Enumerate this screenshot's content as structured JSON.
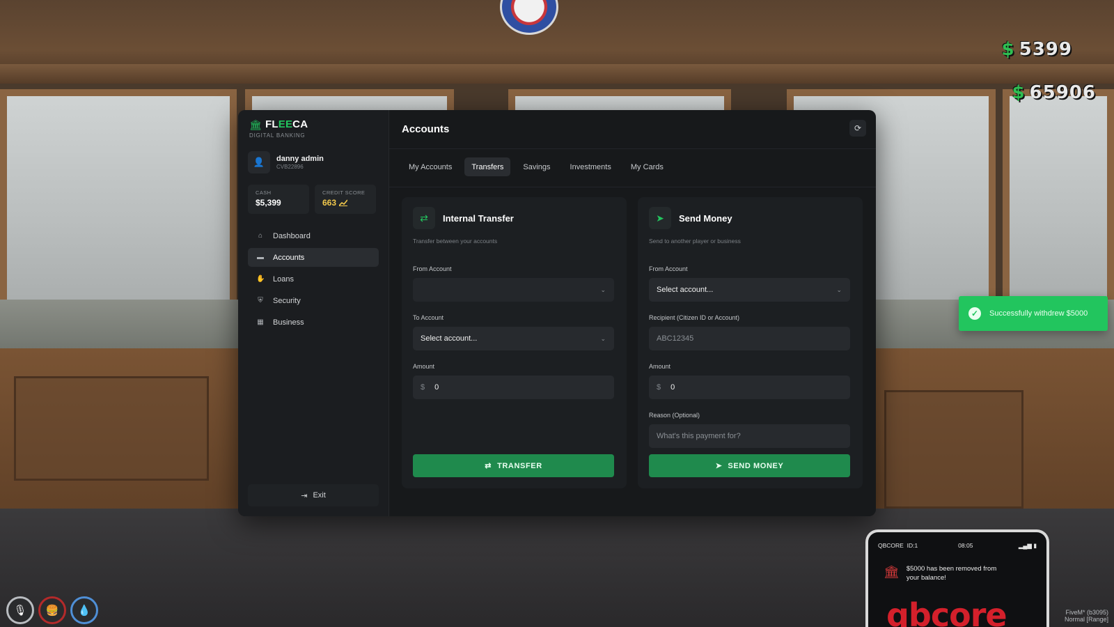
{
  "hud": {
    "cash": "5399",
    "bank": "65906",
    "currency_symbol": "$"
  },
  "toast": {
    "message": "Successfully withdrew $5000"
  },
  "app": {
    "brand": {
      "name_prefix": "FL",
      "name_highlight": "EE",
      "name_suffix": "CA",
      "subtitle": "DIGITAL BANKING"
    },
    "user": {
      "name": "danny admin",
      "citizen_id": "CVB22896"
    },
    "stats": {
      "cash_label": "CASH",
      "cash_value": "$5,399",
      "credit_label": "CREDIT SCORE",
      "credit_value": "663"
    },
    "nav": [
      {
        "label": "Dashboard",
        "icon": "home-icon"
      },
      {
        "label": "Accounts",
        "icon": "wallet-icon",
        "active": true
      },
      {
        "label": "Loans",
        "icon": "hand-coin-icon"
      },
      {
        "label": "Security",
        "icon": "shield-icon"
      },
      {
        "label": "Business",
        "icon": "building-icon"
      }
    ],
    "exit_label": "Exit",
    "header": {
      "title": "Accounts"
    },
    "tabs": [
      {
        "label": "My Accounts"
      },
      {
        "label": "Transfers",
        "active": true
      },
      {
        "label": "Savings"
      },
      {
        "label": "Investments"
      },
      {
        "label": "My Cards"
      }
    ],
    "internal_transfer": {
      "title": "Internal Transfer",
      "subtitle": "Transfer between your accounts",
      "from_label": "From Account",
      "from_value": "",
      "to_label": "To Account",
      "to_value": "Select account...",
      "amount_label": "Amount",
      "currency": "$",
      "amount_value": "0",
      "button": "TRANSFER"
    },
    "send_money": {
      "title": "Send Money",
      "subtitle": "Send to another player or business",
      "from_label": "From Account",
      "from_value": "Select account...",
      "recipient_label": "Recipient (Citizen ID or Account)",
      "recipient_placeholder": "ABC12345",
      "amount_label": "Amount",
      "currency": "$",
      "amount_value": "0",
      "reason_label": "Reason (Optional)",
      "reason_placeholder": "What's this payment for?",
      "button": "SEND MONEY"
    }
  },
  "phone": {
    "carrier": "QBCORE",
    "id": "ID:1",
    "time": "08:05",
    "notification": "$5000 has been removed from your balance!",
    "logo": "qbcore",
    "footer_1": "FiveM* (b3095)",
    "footer_2": "Normal [Range]"
  },
  "colors": {
    "accent": "#22c55e",
    "button": "#1f8a4d",
    "score": "#f2c94c",
    "bg": "#17191b"
  }
}
